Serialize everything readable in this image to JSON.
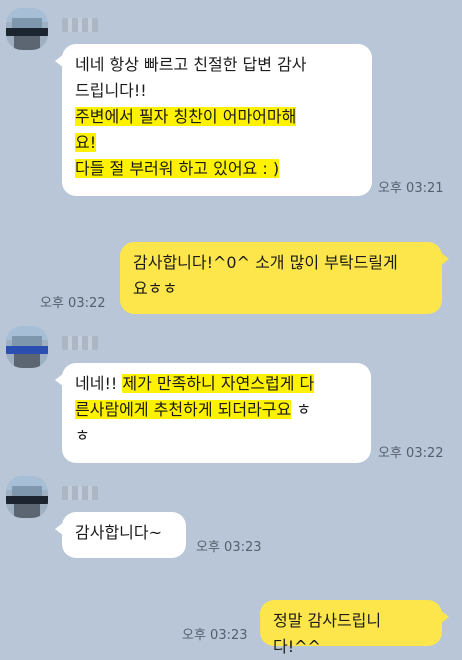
{
  "chat": {
    "messages": [
      {
        "side": "left",
        "lines": [
          "네네 항상 빠르고 친절한 답변 감사",
          "드립니다!!"
        ],
        "highlight_lines": [
          "주변에서 필자 칭찬이 어마어마해",
          "요!",
          "다들 절 부러워 하고 있어요 : )"
        ],
        "time": "오후 03:21"
      },
      {
        "side": "right",
        "lines": [
          "감사합니다!^0^ 소개 많이 부탁드릴게",
          "요ㅎㅎ"
        ],
        "time": "오후 03:22"
      },
      {
        "side": "left",
        "prefix": "네네!! ",
        "highlight_part1": "제가 만족하니 자연스럽게 다",
        "highlight_part2": "른사람에게 추천하게 되더라구요",
        "suffix": " ㅎ",
        "last_line": "ㅎ",
        "time": "오후 03:22"
      },
      {
        "side": "left",
        "lines": [
          "감사합니다~"
        ],
        "time": "오후 03:23"
      },
      {
        "side": "right",
        "lines": [
          "정말 감사드립니다!^^"
        ],
        "time": "오후 03:23"
      }
    ]
  }
}
